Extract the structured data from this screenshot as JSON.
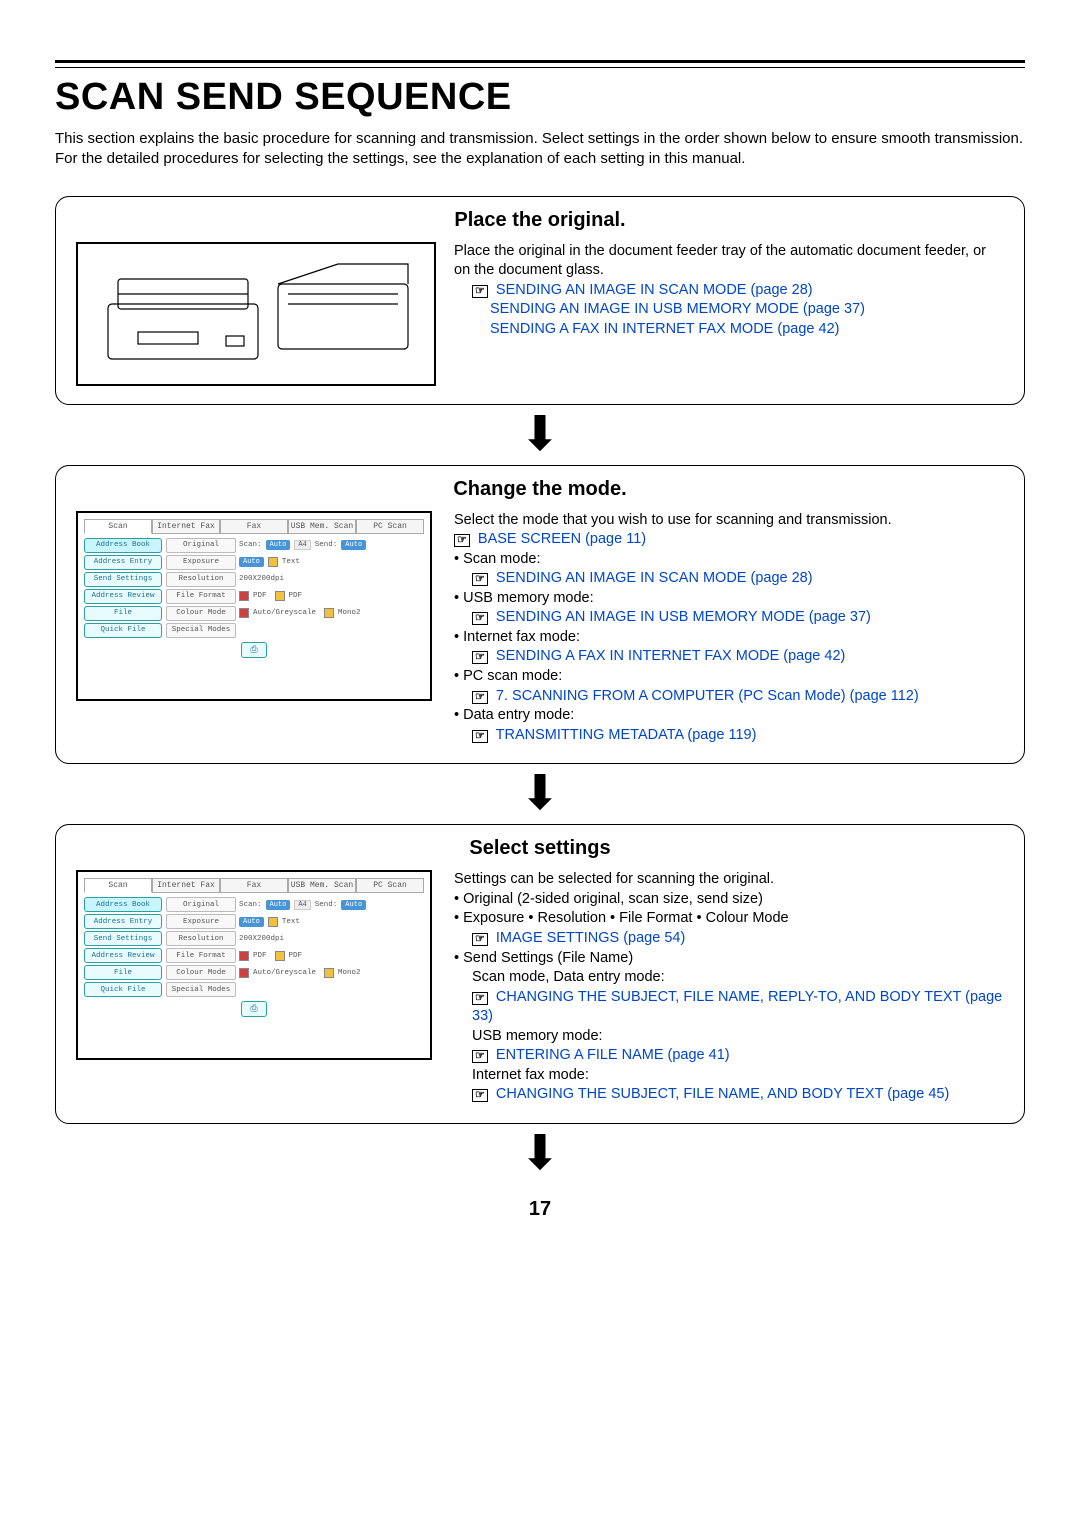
{
  "title": "SCAN SEND SEQUENCE",
  "intro1": "This section explains the basic procedure for scanning and transmission. Select settings in the order shown below to ensure smooth transmission.",
  "intro2": "For the detailed procedures for selecting the settings, see the explanation of each setting in this manual.",
  "page_number": "17",
  "arrow_glyph": "➡",
  "ref_glyph": "☞",
  "steps": [
    {
      "heading": "Place the original.",
      "left_type": "illustration",
      "body_plain": "Place the original in the document feeder tray of the automatic document feeder, or on the document glass.",
      "refs": [
        {
          "text": "SENDING AN IMAGE IN SCAN MODE",
          "suffix": " (page 28)"
        },
        {
          "text": "SENDING AN IMAGE IN USB MEMORY MODE",
          "suffix": " (page 37)"
        },
        {
          "text": "SENDING A FAX IN INTERNET FAX MODE",
          "suffix": " (page 42)"
        }
      ]
    },
    {
      "heading": "Change the mode.",
      "left_type": "ui",
      "body_plain": "Select the mode that you wish to use for scanning and transmission.",
      "first_ref": {
        "text": "BASE SCREEN",
        "suffix": " (page 11)"
      },
      "modes": [
        {
          "label": "Scan mode:",
          "ref_text": "SENDING AN IMAGE IN SCAN MODE",
          "ref_suffix": " (page 28)"
        },
        {
          "label": "USB memory mode:",
          "ref_text": "SENDING AN IMAGE IN USB MEMORY MODE",
          "ref_suffix": " (page 37)"
        },
        {
          "label": "Internet fax mode:",
          "ref_text": "SENDING A FAX IN INTERNET FAX MODE",
          "ref_suffix": " (page 42)"
        },
        {
          "label": "PC scan mode:",
          "ref_text": "7. SCANNING FROM A COMPUTER (PC Scan Mode)",
          "ref_suffix": " (page 112)"
        },
        {
          "label": "Data entry mode:",
          "ref_text": "TRANSMITTING METADATA",
          "ref_suffix": " (page 119)"
        }
      ]
    },
    {
      "heading": "Select settings",
      "left_type": "ui",
      "body_plain": "Settings can be selected for scanning the original.",
      "bullets": [
        "Original (2-sided original, scan size, send size)",
        "Exposure • Resolution • File Format • Colour Mode"
      ],
      "image_settings_ref": {
        "text": "IMAGE SETTINGS",
        "suffix": " (page 54)"
      },
      "send_settings_label": "Send Settings (File Name)",
      "send_modes": [
        {
          "label": "Scan mode, Data entry mode:",
          "ref_text": "CHANGING THE SUBJECT, FILE NAME, REPLY-TO, AND BODY TEXT",
          "ref_suffix": " (page 33)"
        },
        {
          "label": "USB memory mode:",
          "ref_text": "ENTERING A FILE NAME",
          "ref_suffix": " (page 41)"
        },
        {
          "label": "Internet fax mode:",
          "ref_text": "CHANGING THE SUBJECT, FILE NAME, AND BODY TEXT",
          "ref_suffix": " (page 45)"
        }
      ]
    }
  ],
  "ui": {
    "tabs": [
      "Scan",
      "Internet Fax",
      "Fax",
      "USB Mem. Scan",
      "PC Scan"
    ],
    "side": [
      "Address Book",
      "Address Entry",
      "Send Settings",
      "Address Review",
      "File",
      "Quick File"
    ],
    "rows": [
      {
        "btn": "Original",
        "content": [
          "Scan:",
          {
            "chip": "Auto"
          },
          {
            "chipg": "A4"
          },
          "  Send:",
          {
            "chip": "Auto"
          }
        ]
      },
      {
        "btn": "Exposure",
        "content": [
          {
            "chip": "Auto"
          },
          {
            "sq": "1"
          },
          "Text"
        ]
      },
      {
        "btn": "Resolution",
        "content": [
          "200X200dpi"
        ]
      },
      {
        "btn": "File Format",
        "content": [
          {
            "sq2": "1"
          },
          "PDF",
          "            ",
          {
            "sq": "1"
          },
          "PDF"
        ]
      },
      {
        "btn": "Colour Mode",
        "content": [
          {
            "sq2": "1"
          },
          "Auto/Greyscale",
          "   ",
          {
            "sq": "1"
          },
          "Mono2"
        ]
      },
      {
        "btn": "Special Modes",
        "content": []
      }
    ],
    "preview_btn": "⎙"
  }
}
